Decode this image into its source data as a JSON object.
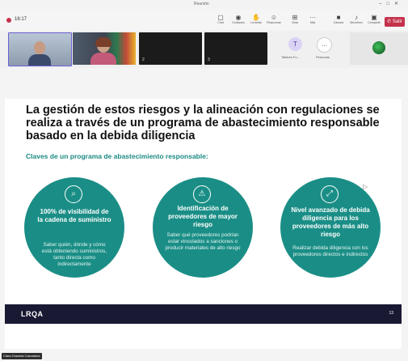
{
  "window": {
    "title": "Reunión"
  },
  "toolbar": {
    "timer": "16:17",
    "buttons": [
      {
        "label": "Chat"
      },
      {
        "label": "Contactos"
      },
      {
        "label": "Levantar"
      },
      {
        "label": "Reaccionar"
      },
      {
        "label": "Vista"
      },
      {
        "label": "Más"
      },
      {
        "label": "Cámara"
      },
      {
        "label": "Micrófono"
      },
      {
        "label": "Compartir"
      }
    ],
    "leave_label": "Salir"
  },
  "participants": {
    "tiles": [
      {
        "number": ""
      },
      {
        "number": ""
      },
      {
        "number": "2"
      },
      {
        "number": "3"
      }
    ],
    "avatar_initial": "T",
    "avatar_name": "Talleres Fo... ",
    "more_label": "...",
    "more_name": "Personas"
  },
  "slide": {
    "heading": "La gestión de estos riesgos y la alineación con regulaciones se realiza a través de un programa de abastecimiento responsable basado en la debida diligencia",
    "subheading": "Claves de un programa de abastecimiento responsable:",
    "circles": [
      {
        "title": "100% de visibilidad de la cadena de suministro",
        "body": "Saber quién, dónde y cómo está obteniendo suministros, tanto directa como indirectamente",
        "icon": "search-document-icon"
      },
      {
        "title": "Identificación de proveedores de mayor riesgo",
        "body": "Saber qué proveedores podrían estar vinculados a sanciones o producir materiales de alto riesgo",
        "icon": "warning-document-icon"
      },
      {
        "title": "Nivel avanzado de debida diligencia para los proveedores de más alto riesgo",
        "body": "Realizar debida diligencia con los proveedores directos e indirectos",
        "icon": "magnifier-icon"
      }
    ],
    "footer_logo": "LRQA",
    "page_number": "13"
  },
  "share_label": "Clara Graciela Cacciabue",
  "colors": {
    "teal": "#1a8e86",
    "navy": "#191933",
    "leave": "#c4314b"
  }
}
